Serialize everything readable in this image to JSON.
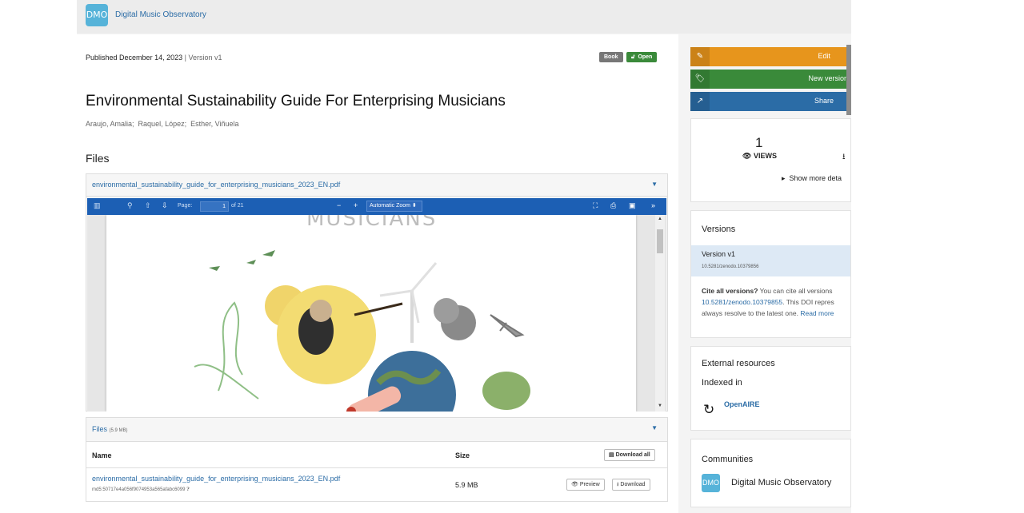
{
  "header": {
    "logo_text": "DMO",
    "brand": "Digital Music Observatory"
  },
  "record": {
    "published_prefix": "Published",
    "published_date": "December 14, 2023",
    "version_sep": "|",
    "version": "Version v1",
    "badges": {
      "type": "Book",
      "access": "Open"
    },
    "title": "Environmental Sustainability Guide For Enterprising Musicians",
    "authors": [
      "Araujo, Amalia",
      "Raquel, López",
      "Esther, Viñuela"
    ]
  },
  "files_section": {
    "heading": "Files",
    "preview_filename": "environmental_sustainability_guide_for_enterprising_musicians_2023_EN.pdf",
    "viewer": {
      "page_label": "Page:",
      "page": "1",
      "of_pages": "of 21",
      "zoom": "Automatic Zoom",
      "page_heading": "MUSICIANS"
    },
    "files_label": "Files",
    "files_size": "(5.9 MB)",
    "columns": {
      "name": "Name",
      "size": "Size"
    },
    "download_all": "Download all",
    "rows": [
      {
        "filename": "environmental_sustainability_guide_for_enterprising_musicians_2023_EN.pdf",
        "md5": "md5:50717e4a056f9074953a565afabc6099",
        "size": "5.9 MB",
        "preview": "Preview",
        "download": "Download"
      }
    ]
  },
  "sidebar": {
    "edit": "Edit",
    "new_version": "New version",
    "share": "Share",
    "views": "1",
    "views_label": "VIEWS",
    "show_more": "Show more deta",
    "versions_title": "Versions",
    "version_name": "Version v1",
    "version_doi": "10.5281/zenodo.10379856",
    "cite_bold": "Cite all versions?",
    "cite_1": " You can cite all versions",
    "cite_doi": "10.5281/zenodo.10379855",
    "cite_2": ". This DOI repres",
    "cite_3": "always resolve to the latest one. ",
    "read_more": "Read more",
    "ext_title": "External resources",
    "indexed_in": "Indexed in",
    "openaire": "OpenAIRE",
    "communities_title": "Communities",
    "community_logo": "DMO",
    "community_name": "Digital Music Observatory"
  }
}
